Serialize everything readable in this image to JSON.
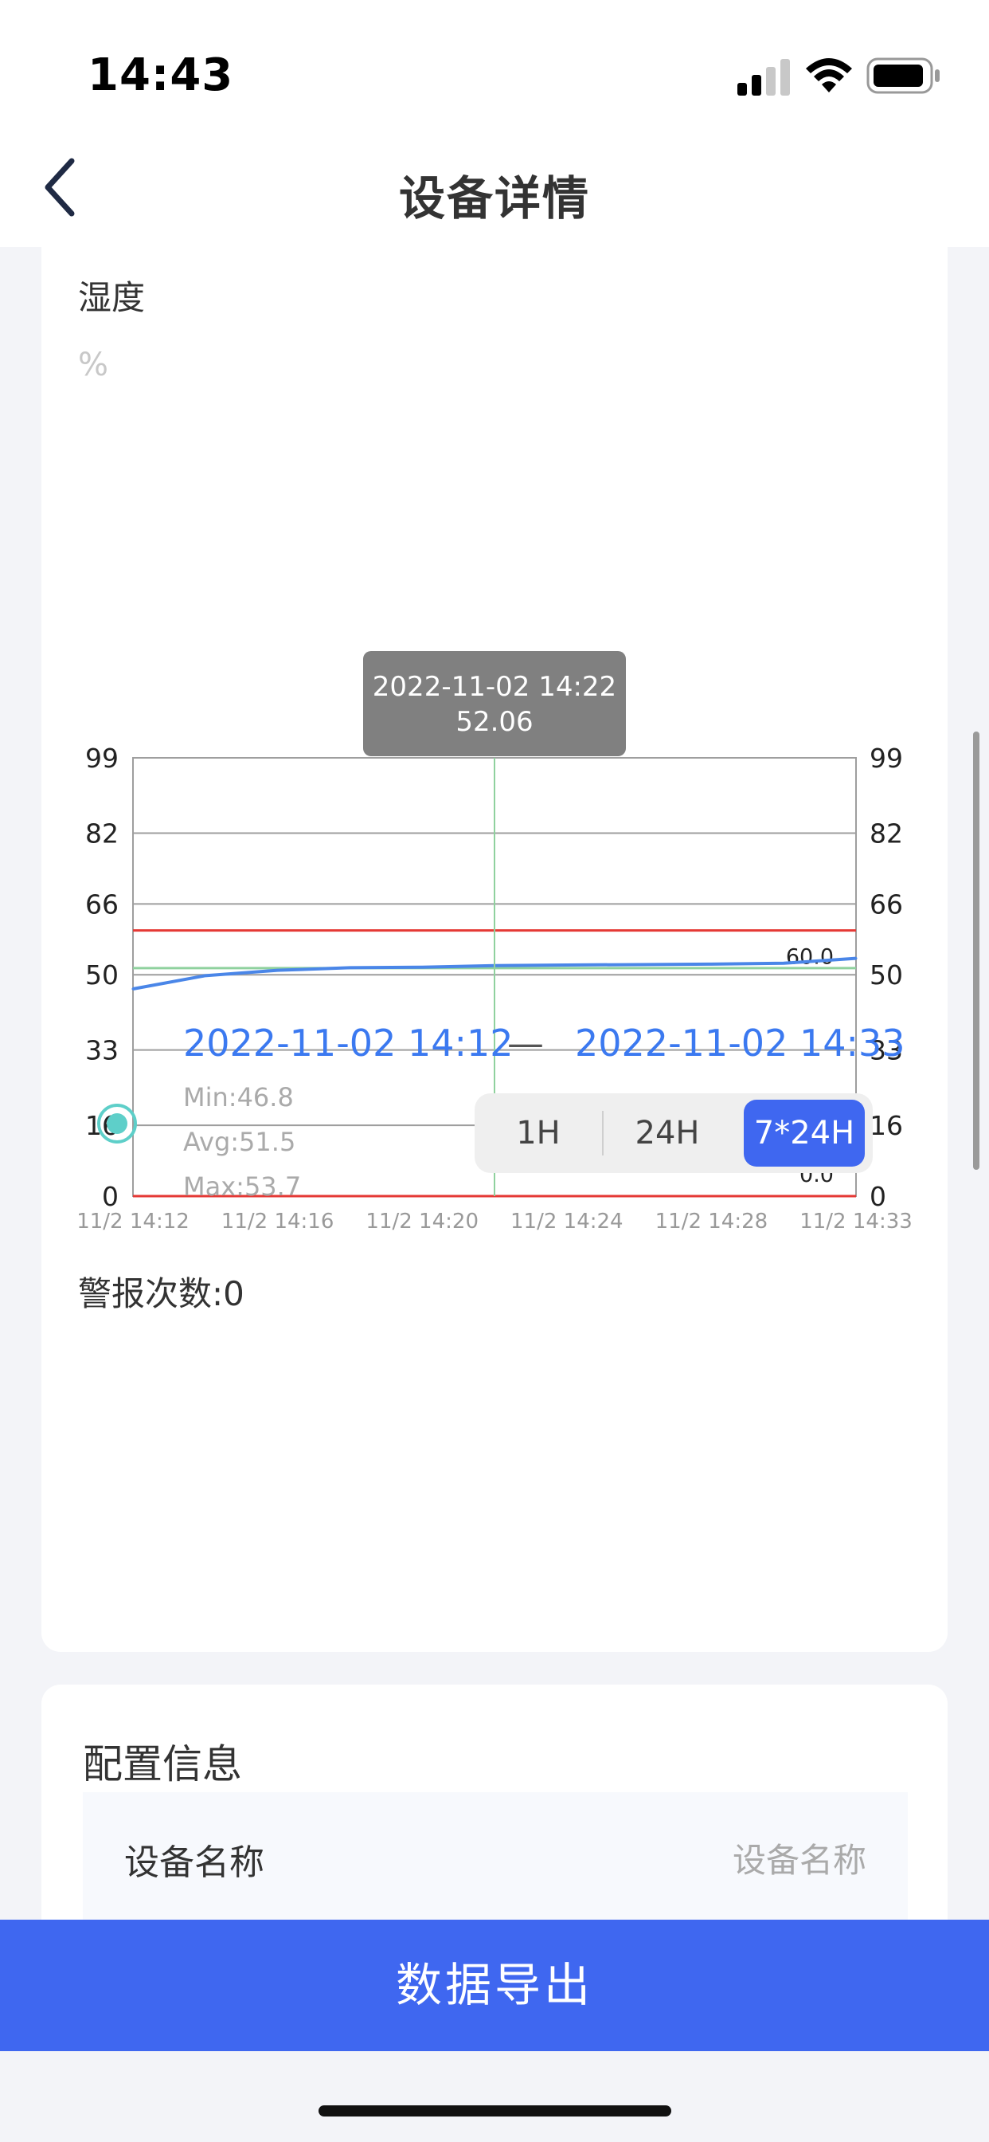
{
  "status_bar": {
    "time": "14:43"
  },
  "nav": {
    "title": "设备详情"
  },
  "humidity": {
    "title": "湿度",
    "unit": "%",
    "range_start": "2022-11-02 14:12",
    "range_separator": "—",
    "range_end": "2022-11-02 14:33",
    "stats": {
      "min": "Min:46.8",
      "avg": "Avg:51.5",
      "max": "Max:53.7"
    },
    "ranges": [
      "1H",
      "24H",
      "7*24H"
    ],
    "selected_range": "7*24H",
    "alarm_label": "警报次数:0"
  },
  "chart_data": {
    "type": "line",
    "x": [
      "11/2 14:12",
      "11/2 14:14",
      "11/2 14:16",
      "11/2 14:18",
      "11/2 14:20",
      "11/2 14:22",
      "11/2 14:24",
      "11/2 14:26",
      "11/2 14:28",
      "11/2 14:31",
      "11/2 14:33"
    ],
    "x_tick_labels": [
      "11/2 14:12",
      "11/2 14:16",
      "11/2 14:20",
      "11/2 14:24",
      "11/2 14:28",
      "11/2 14:33"
    ],
    "series": [
      {
        "values": [
          46.8,
          49.8,
          51.0,
          51.6,
          51.7,
          52.06,
          52.2,
          52.3,
          52.4,
          52.6,
          53.7
        ],
        "color": "#4a86e8"
      }
    ],
    "reference_lines": [
      {
        "label": "60.0",
        "value": 60.0,
        "color": "#e53935"
      },
      {
        "label": "0.0",
        "value": 0.0,
        "color": "#e53935"
      },
      {
        "value": 51.5,
        "color": "#8fd19e"
      }
    ],
    "ylim": [
      0,
      99
    ],
    "y_ticks": [
      "0",
      "16",
      "33",
      "50",
      "66",
      "82",
      "99"
    ],
    "grid": true,
    "tooltip": {
      "time": "2022-11-02 14:22",
      "value": "52.06"
    }
  },
  "config": {
    "title": "配置信息",
    "rows": [
      {
        "label": "设备名称",
        "value": "设备名称"
      }
    ]
  },
  "export": {
    "label": "数据导出"
  },
  "colors": {
    "primary": "#3f67f0",
    "accent_blue": "#3b79f0",
    "teal": "#5ecfc9",
    "alert_red": "#e53935"
  }
}
